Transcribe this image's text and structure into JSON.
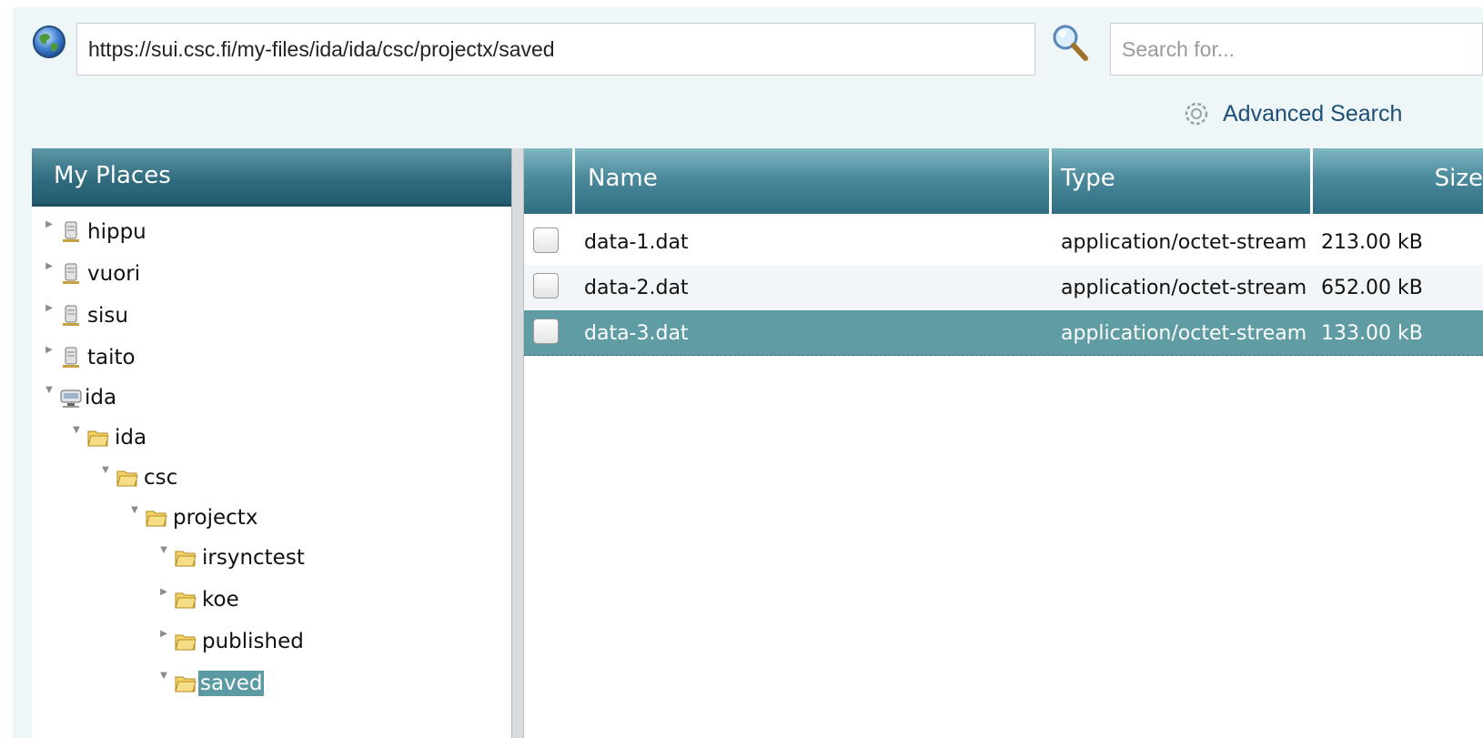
{
  "top": {
    "url": "https://sui.csc.fi/my-files/ida/ida/csc/projectx/saved",
    "search_placeholder": "Search for...",
    "advanced_search": "Advanced Search"
  },
  "places": {
    "title": "My Places",
    "nodes": [
      {
        "label": "hippu",
        "icon": "server-icon",
        "expanded": false
      },
      {
        "label": "vuori",
        "icon": "server-icon",
        "expanded": false
      },
      {
        "label": "sisu",
        "icon": "server-icon",
        "expanded": false
      },
      {
        "label": "taito",
        "icon": "server-icon",
        "expanded": false
      },
      {
        "label": "ida",
        "icon": "storage-drive-icon",
        "expanded": true
      },
      {
        "label": "ida",
        "icon": "folder-icon",
        "expanded": true
      },
      {
        "label": "csc",
        "icon": "folder-icon",
        "expanded": true
      },
      {
        "label": "projectx",
        "icon": "folder-icon",
        "expanded": true
      },
      {
        "label": "irsynctest",
        "icon": "folder-icon",
        "expanded": true
      },
      {
        "label": "koe",
        "icon": "folder-icon",
        "expanded": false
      },
      {
        "label": "published",
        "icon": "folder-icon",
        "expanded": false
      },
      {
        "label": "saved",
        "icon": "folder-icon",
        "expanded": true,
        "selected": true
      }
    ]
  },
  "files": {
    "columns": [
      "Name",
      "Type",
      "Size"
    ],
    "rows": [
      {
        "name": "data-1.dat",
        "type": "application/octet-stream",
        "size": "213.00 kB",
        "selected": false
      },
      {
        "name": "data-2.dat",
        "type": "application/octet-stream",
        "size": "652.00 kB",
        "selected": false
      },
      {
        "name": "data-3.dat",
        "type": "application/octet-stream",
        "size": "133.00 kB",
        "selected": true
      }
    ]
  },
  "colors": {
    "header_teal": "#2e6a7d",
    "selection": "#5f9ca4",
    "link": "#1d4e76",
    "background": "#eef6f8"
  }
}
